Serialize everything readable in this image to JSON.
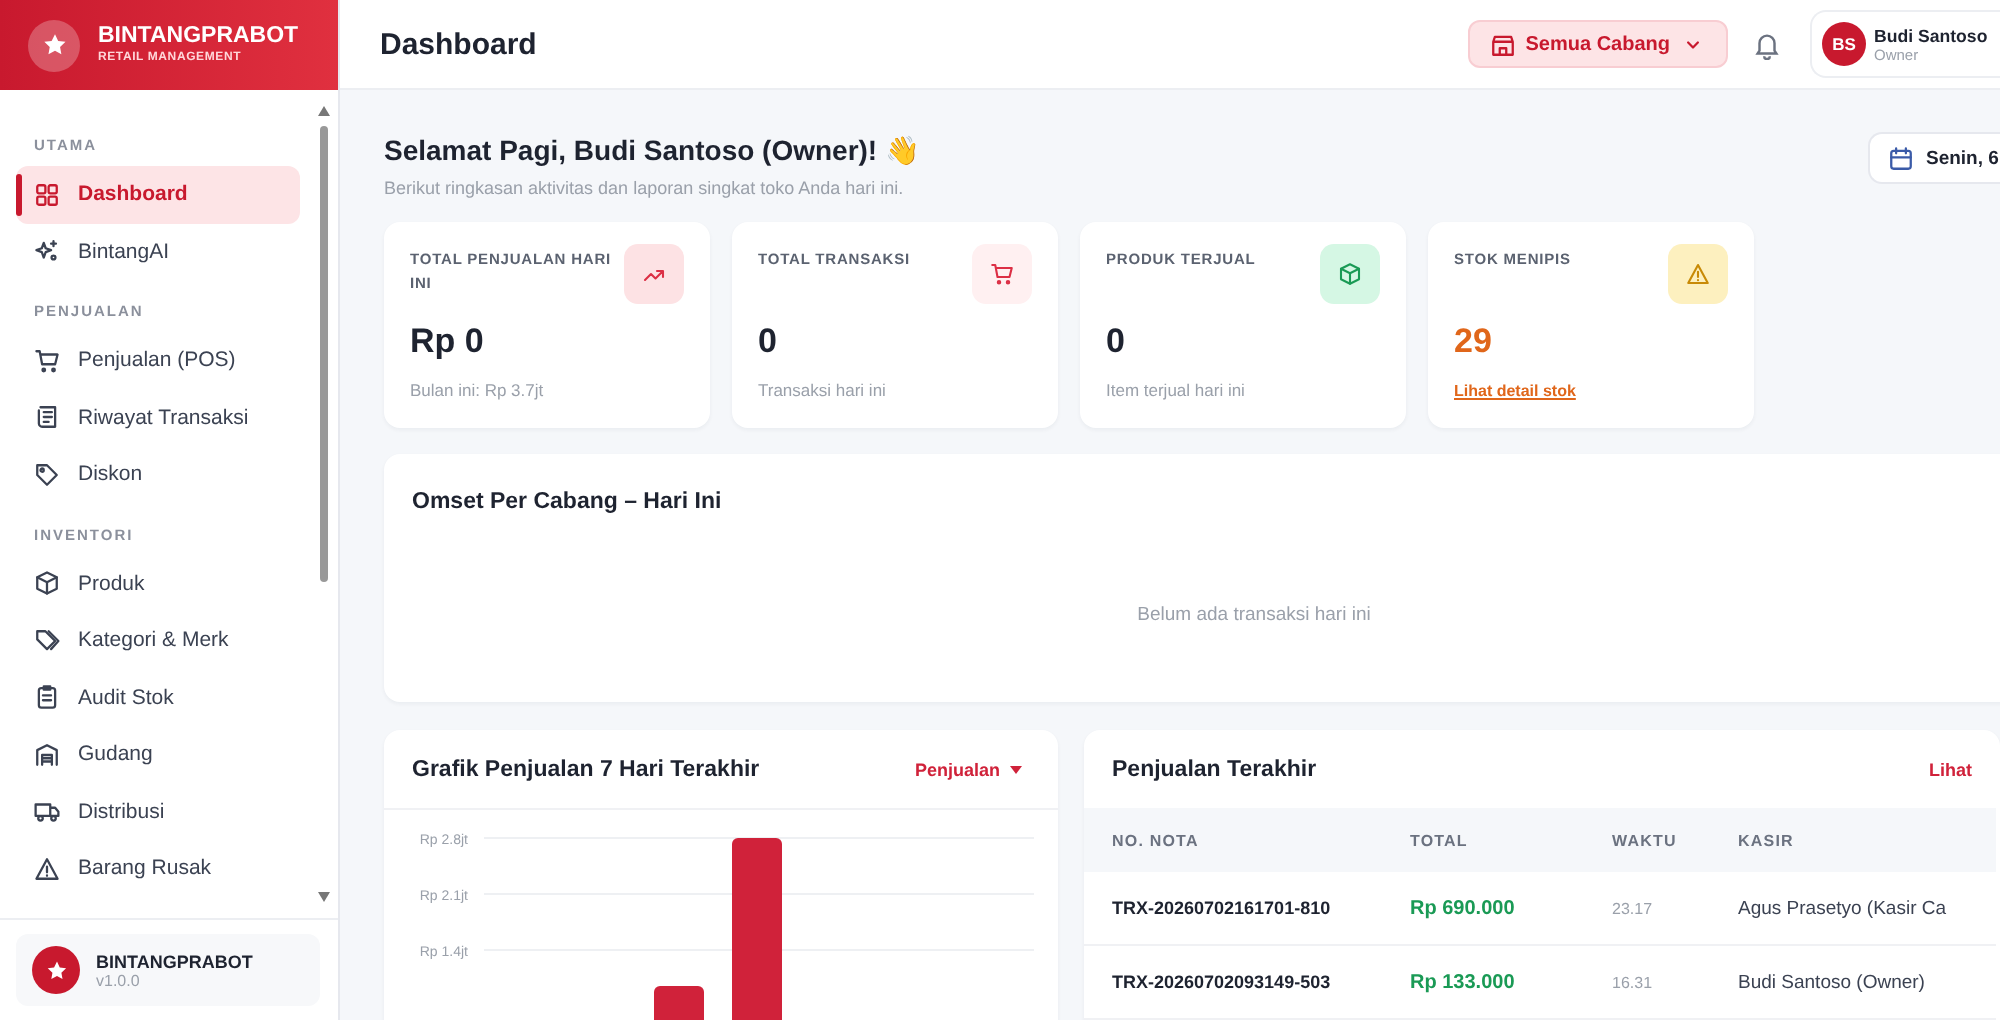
{
  "brand": {
    "name": "BINTANGPRABOT",
    "tagline": "RETAIL MANAGEMENT"
  },
  "sidebar": {
    "sections": [
      {
        "title": "UTAMA",
        "items": [
          {
            "label": "Dashboard",
            "selected": true
          },
          {
            "label": "BintangAI",
            "selected": false
          }
        ]
      },
      {
        "title": "PENJUALAN",
        "items": [
          {
            "label": "Penjualan (POS)",
            "selected": false
          },
          {
            "label": "Riwayat Transaksi",
            "selected": false
          },
          {
            "label": "Diskon",
            "selected": false
          }
        ]
      },
      {
        "title": "INVENTORI",
        "items": [
          {
            "label": "Produk",
            "selected": false
          },
          {
            "label": "Kategori & Merk",
            "selected": false
          },
          {
            "label": "Audit Stok",
            "selected": false
          },
          {
            "label": "Gudang",
            "selected": false
          },
          {
            "label": "Distribusi",
            "selected": false
          },
          {
            "label": "Barang Rusak",
            "selected": false
          }
        ]
      }
    ],
    "footer": {
      "name": "BINTANGPRABOT",
      "version": "v1.0.0"
    }
  },
  "header": {
    "title": "Dashboard",
    "branch_button": "Semua Cabang",
    "user": {
      "initials": "BS",
      "name": "Budi Santoso",
      "role": "Owner"
    }
  },
  "greeting": {
    "title": "Selamat Pagi, Budi Santoso (Owner)! 👋",
    "subtitle": "Berikut ringkasan aktivitas dan laporan singkat toko Anda hari ini.",
    "date": "Senin, 6"
  },
  "stats": [
    {
      "kind": "normal",
      "label": "TOTAL PENJUALAN HARI INI",
      "value": "Rp 0",
      "note": "Bulan ini: Rp 3.7jt"
    },
    {
      "kind": "normal",
      "label": "TOTAL TRANSAKSI",
      "value": "0",
      "note": "Transaksi hari ini"
    },
    {
      "kind": "normal",
      "label": "PRODUK TERJUAL",
      "value": "0",
      "note": "Item terjual hari ini"
    },
    {
      "kind": "warning",
      "label": "STOK MENIPIS",
      "value": "29",
      "note": "Lihat detail stok"
    }
  ],
  "omset": {
    "title": "Omset Per Cabang – Hari Ini",
    "empty": "Belum ada transaksi hari ini"
  },
  "sales_chart": {
    "title": "Grafik Penjualan 7 Hari Terakhir",
    "dropdown": "Penjualan",
    "y_axis_labels": [
      "Rp 2.8jt",
      "Rp 2.1jt",
      "Rp 1.4jt"
    ]
  },
  "recent_sales": {
    "title": "Penjualan Terakhir",
    "link": "Lihat",
    "columns": [
      "NO. NOTA",
      "TOTAL",
      "WAKTU",
      "KASIR"
    ],
    "rows": [
      [
        "TRX-20260702161701-810",
        "Rp 690.000",
        "23.17",
        "Agus Prasetyo (Kasir Ca"
      ],
      [
        "TRX-20260702093149-503",
        "Rp 133.000",
        "16.31",
        "Budi Santoso (Owner)"
      ]
    ]
  }
}
